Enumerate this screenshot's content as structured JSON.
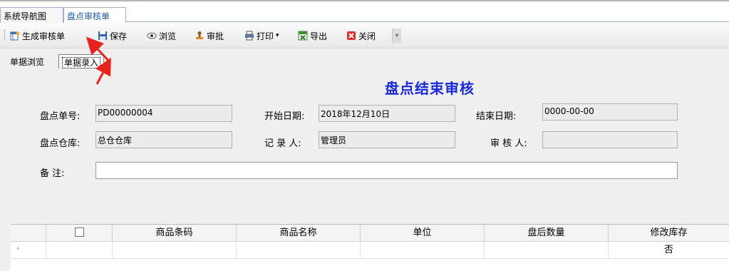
{
  "doc_tabs": [
    "系统导航图",
    "盘点审核单"
  ],
  "toolbar": {
    "generate": "生成审核单",
    "save": "保存",
    "browse": "浏览",
    "approve": "审批",
    "print": "打印",
    "print_caret": "▾",
    "export": "导出",
    "close": "关闭",
    "more": "▾"
  },
  "view_tabs": [
    "单据浏览",
    "单据录入"
  ],
  "form": {
    "title": "盘点结束审核",
    "count_no_label": "盘点单号:",
    "count_no": "PD00000004",
    "start_label": "开始日期:",
    "start_date": "2018年12月10日",
    "end_label": "结束日期:",
    "end_date": "0000-00-00",
    "warehouse_label": "盘点仓库:",
    "warehouse": "总仓仓库",
    "recorder_label": "记 录 人:",
    "recorder": "管理员",
    "reviewer_label": "审 核 人:",
    "reviewer": "",
    "remark_label": "备    注:",
    "remark": ""
  },
  "grid": {
    "columns": [
      "商品条码",
      "商品名称",
      "单位",
      "盘后数量",
      "修改库存"
    ],
    "new_row_marker": "*",
    "new_row_modify_stock": "否"
  }
}
